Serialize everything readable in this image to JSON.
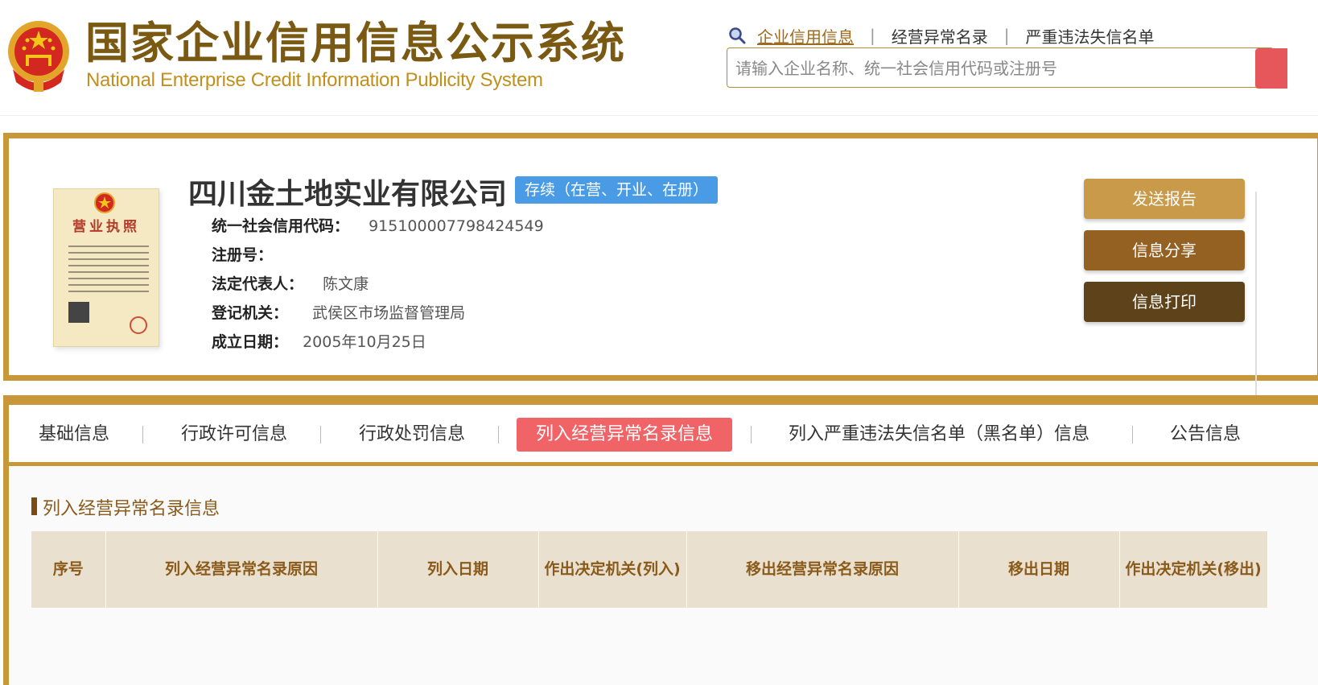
{
  "header": {
    "title_cn": "国家企业信用信息公示系统",
    "title_en": "National Enterprise Credit Information Publicity System",
    "nav": [
      {
        "label": "企业信用信息",
        "active": true
      },
      {
        "label": "经营异常名录",
        "active": false
      },
      {
        "label": "严重违法失信名单",
        "active": false
      }
    ],
    "nav_separator": "|",
    "search_placeholder": "请输入企业名称、统一社会信用代码或注册号"
  },
  "license_image": {
    "title": "营业执照"
  },
  "company": {
    "name": "四川金土地实业有限公司",
    "status": "存续（在营、开业、在册）",
    "fields": [
      {
        "label": "统一社会信用代码：",
        "value": "915100007798424549"
      },
      {
        "label": "注册号：",
        "value": ""
      },
      {
        "label": "法定代表人：",
        "value": "陈文康"
      },
      {
        "label": "登记机关：",
        "value": "武侯区市场监督管理局"
      },
      {
        "label": "成立日期：",
        "value": "2005年10月25日"
      }
    ]
  },
  "actions": {
    "send": "发送报告",
    "share": "信息分享",
    "print": "信息打印"
  },
  "tabs": [
    {
      "label": "基础信息"
    },
    {
      "label": "行政许可信息"
    },
    {
      "label": "行政处罚信息"
    },
    {
      "label": "列入经营异常名录信息"
    },
    {
      "label": "列入严重违法失信名单（黑名单）信息"
    },
    {
      "label": "公告信息"
    }
  ],
  "section": {
    "title": "列入经营异常名录信息",
    "columns": [
      "序号",
      "列入经营异常名录原因",
      "列入日期",
      "作出决定机关(列入)",
      "移出经营异常名录原因",
      "移出日期",
      "作出决定机关(移出)"
    ]
  },
  "colors": {
    "gold_border": "#c8973a",
    "brand_brown": "#7a5a12",
    "status_blue": "#4a9be6",
    "active_tab_red": "#f06468"
  }
}
